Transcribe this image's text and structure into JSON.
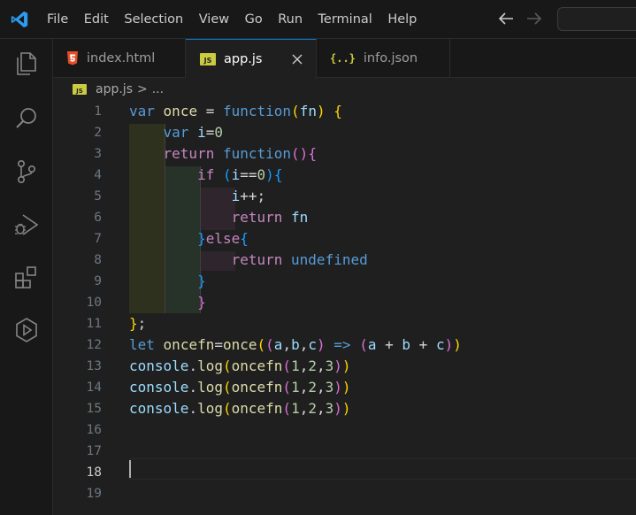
{
  "menu": [
    "File",
    "Edit",
    "Selection",
    "View",
    "Go",
    "Run",
    "Terminal",
    "Help"
  ],
  "tabs": [
    {
      "label": "index.html",
      "icon": "html5-icon"
    },
    {
      "label": "app.js",
      "icon": "js-icon",
      "active": true
    },
    {
      "label": "info.json",
      "icon": "json-icon"
    }
  ],
  "tab_icon_text": {
    "js": "JS",
    "json": "{..}"
  },
  "breadcrumb": {
    "file": "app.js",
    "separator": ">",
    "more": "..."
  },
  "editor": {
    "current_line": 18,
    "line_numbers": [
      "1",
      "2",
      "3",
      "4",
      "5",
      "6",
      "7",
      "8",
      "9",
      "10",
      "11",
      "12",
      "13",
      "14",
      "15",
      "16",
      "17",
      "18",
      "19"
    ],
    "lines": [
      "var once = function(fn) {",
      "    var i=0",
      "    return function(){",
      "        if (i==0){",
      "            i++;",
      "            return fn",
      "        }else{",
      "            return undefined",
      "        }",
      "        }",
      "};",
      "let oncefn=once((a,b,c) => (a + b + c))",
      "console.log(oncefn(1,2,3))",
      "console.log(oncefn(1,2,3))",
      "console.log(oncefn(1,2,3))",
      "",
      "",
      "",
      ""
    ]
  },
  "colors": {
    "keyword": "#569cd6",
    "control_keyword": "#c586c0",
    "variable": "#9cdcfe",
    "function": "#dcdcaa",
    "number": "#b5cea8",
    "bracket_gold": "#ffd700",
    "bracket_orchid": "#da70d6",
    "bracket_blue": "#179fff",
    "tab_active_border": "#0078d4",
    "js_icon": "#cbcb41",
    "html_icon": "#e44d26"
  }
}
